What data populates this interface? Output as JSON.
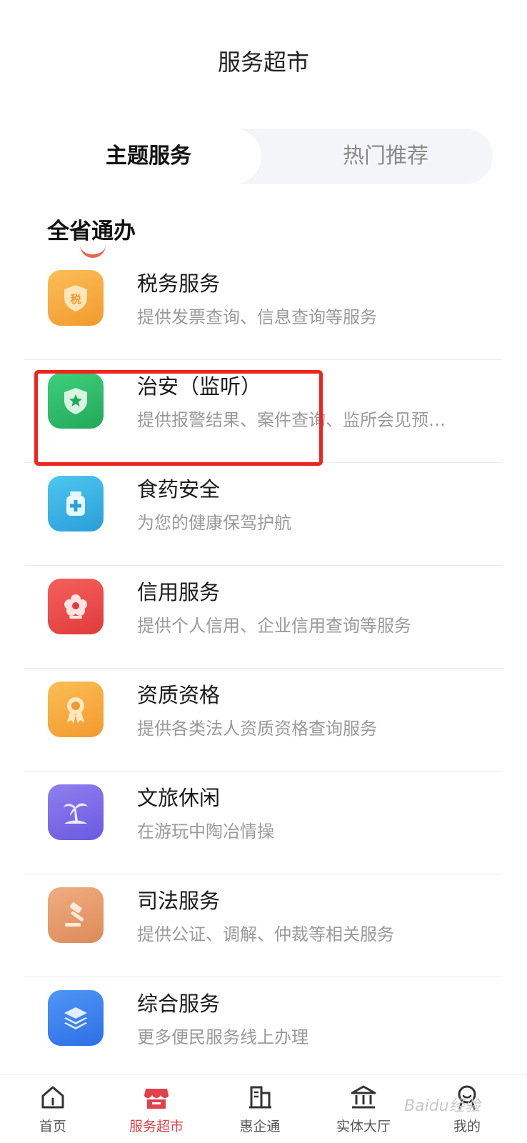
{
  "header": {
    "title": "服务超市"
  },
  "tabs": [
    {
      "label": "主题服务",
      "active": true
    },
    {
      "label": "热门推荐",
      "active": false
    }
  ],
  "section": {
    "title": "全省通办"
  },
  "services": [
    {
      "title": "税务服务",
      "desc": "提供发票查询、信息查询等服务",
      "icon": "tax-shield-icon",
      "color": "#f7a53b"
    },
    {
      "title": "治安（监听）",
      "desc": "提供报警结果、案件查询、监所会见预…",
      "icon": "police-shield-icon",
      "color": "#2fbf6b"
    },
    {
      "title": "食药安全",
      "desc": "为您的健康保驾护航",
      "icon": "medicine-bottle-icon",
      "color": "#3bb3e6"
    },
    {
      "title": "信用服务",
      "desc": "提供个人信用、企业信用查询等服务",
      "icon": "flower-icon",
      "color": "#ef4b4b"
    },
    {
      "title": "资质资格",
      "desc": "提供各类法人资质资格查询服务",
      "icon": "award-badge-icon",
      "color": "#f8a43a"
    },
    {
      "title": "文旅休闲",
      "desc": "在游玩中陶冶情操",
      "icon": "palm-tree-icon",
      "color": "#7b6be8"
    },
    {
      "title": "司法服务",
      "desc": "提供公证、调解、仲裁等相关服务",
      "icon": "gavel-icon",
      "color": "#e8986a"
    },
    {
      "title": "综合服务",
      "desc": "更多便民服务线上办理",
      "icon": "layers-icon",
      "color": "#3a7ef0"
    }
  ],
  "tabbar": [
    {
      "label": "首页",
      "icon": "home-icon",
      "active": false
    },
    {
      "label": "服务超市",
      "icon": "store-icon",
      "active": true
    },
    {
      "label": "惠企通",
      "icon": "building-icon",
      "active": false
    },
    {
      "label": "实体大厅",
      "icon": "bank-hall-icon",
      "active": false
    },
    {
      "label": "我的",
      "icon": "user-icon",
      "active": false
    }
  ],
  "watermark": "Baidu经验"
}
